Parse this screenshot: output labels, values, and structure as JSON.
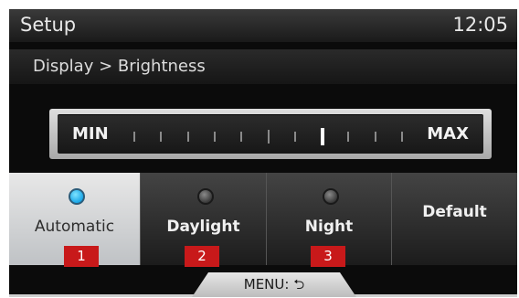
{
  "header": {
    "title": "Setup",
    "clock": "12:05"
  },
  "breadcrumb": "Display > Brightness",
  "slider": {
    "min_label": "MIN",
    "max_label": "MAX",
    "tick_count": 11,
    "current_tick": 7,
    "center_tick": 5
  },
  "modes": [
    {
      "label": "Automatic",
      "selected": true,
      "has_indicator": true
    },
    {
      "label": "Daylight",
      "selected": false,
      "has_indicator": true
    },
    {
      "label": "Night",
      "selected": false,
      "has_indicator": true
    },
    {
      "label": "Default",
      "selected": false,
      "has_indicator": false
    }
  ],
  "badges": [
    "1",
    "2",
    "3"
  ],
  "menu": {
    "label": "MENU: ⮌"
  },
  "colors": {
    "indicator_active": "#1aa7e8",
    "badge": "#c8191a"
  }
}
